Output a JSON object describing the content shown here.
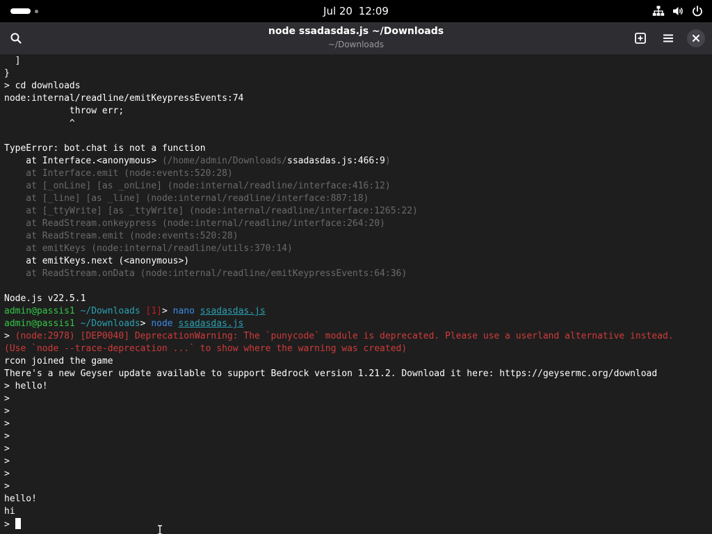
{
  "topbar": {
    "date": "Jul 20",
    "time": "12:09"
  },
  "header": {
    "title": "node ssadasdas.js ~/Downloads",
    "subtitle": "~/Downloads"
  },
  "icons": {
    "search": "search-icon",
    "new_tab": "new-tab-icon",
    "menu": "hamburger-menu-icon",
    "close": "close-icon",
    "network": "network-icon",
    "volume": "volume-icon",
    "power": "power-icon"
  },
  "colors": {
    "prompt_green": "#33c748",
    "path_cyan": "#2aa1b3",
    "error_red": "#c01c28",
    "command_blue": "#3b8eea",
    "terminal_bg": "#1e1e1e"
  },
  "terminal": {
    "l01": "  ]",
    "l02": "}",
    "l03": "> cd downloads",
    "l04": "node:internal/readline/emitKeypressEvents:74",
    "l05": "            throw err;",
    "l06": "            ^",
    "l07": "",
    "l08": "TypeError: bot.chat is not a function",
    "l09a": "    at Interface.<anonymous> ",
    "l09b": "(/home/admin/Downloads/",
    "l09c": "ssadasdas.js:466:9",
    "l09d": ")",
    "l10": "    at Interface.emit (node:events:520:28)",
    "l11": "    at [_onLine] [as _onLine] (node:internal/readline/interface:416:12)",
    "l12": "    at [_line] [as _line] (node:internal/readline/interface:887:18)",
    "l13": "    at [_ttyWrite] [as _ttyWrite] (node:internal/readline/interface:1265:22)",
    "l14": "    at ReadStream.onkeypress (node:internal/readline/interface:264:20)",
    "l15": "    at ReadStream.emit (node:events:520:28)",
    "l16": "    at emitKeys (node:internal/readline/utils:370:14)",
    "l17": "    at emitKeys.next (<anonymous>)",
    "l18": "    at ReadStream.onData (node:internal/readline/emitKeypressEvents:64:36)",
    "l19": "",
    "l20": "Node.js v22.5.1",
    "p1_user": "admin@passis1",
    "p1_path": " ~/Downloads ",
    "p1_status": "[1]",
    "p1_arrow": "> ",
    "p1_cmd": "nano",
    "p1_space": " ",
    "p1_file": "ssadasdas.js",
    "p2_user": "admin@passis1",
    "p2_path": " ~/Downloads",
    "p2_arrow": "> ",
    "p2_cmd": "node",
    "p2_space": " ",
    "p2_file": "ssadasdas.js",
    "l23a": "> ",
    "l23b": "(node:2978) [DEP0040] DeprecationWarning: The `punycode` module is deprecated. Please use a userland alternative instead.",
    "l24": "(Use `node --trace-deprecation ...` to show where the warning was created)",
    "l25": "rcon joined the game",
    "l26": "There's a new Geyser update available to support Bedrock version 1.21.2. Download it here: https://geysermc.org/download",
    "l27": "> hello!",
    "l28": ">",
    "l29": ">",
    "l30": ">",
    "l31": ">",
    "l32": ">",
    "l33": ">",
    "l34": ">",
    "l35": ">",
    "l36": "hello!",
    "l37": "hi",
    "l38": "> "
  }
}
